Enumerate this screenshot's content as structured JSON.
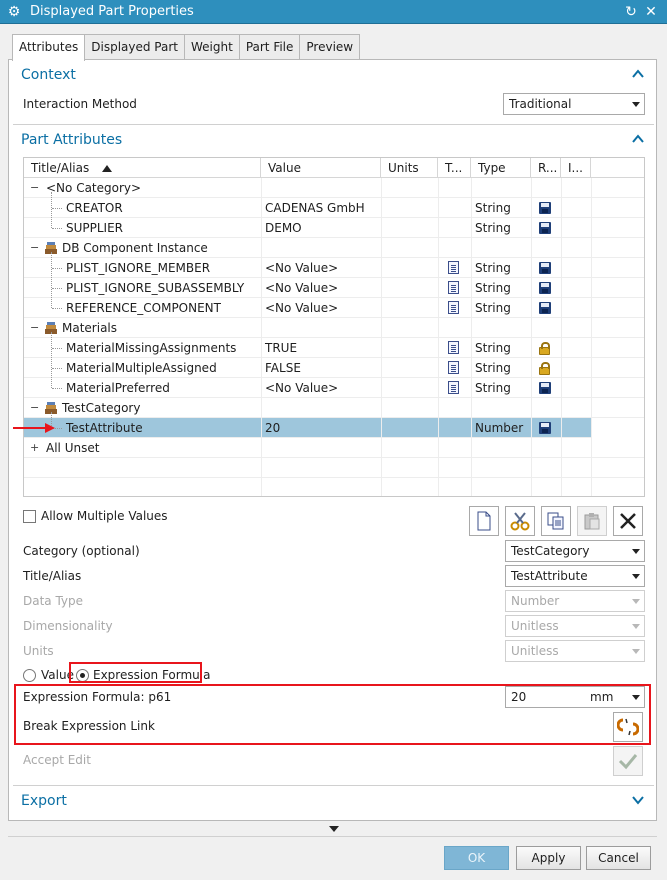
{
  "window": {
    "title": "Displayed Part Properties",
    "gear_icon": "gear-icon",
    "reset_icon": "reset-icon",
    "close_icon": "close-icon"
  },
  "tabs": [
    {
      "label": "Attributes",
      "active": true
    },
    {
      "label": "Displayed Part"
    },
    {
      "label": "Weight"
    },
    {
      "label": "Part File"
    },
    {
      "label": "Preview"
    }
  ],
  "context": {
    "title": "Context",
    "interaction_method_label": "Interaction Method",
    "interaction_method_value": "Traditional"
  },
  "part_attributes": {
    "title": "Part Attributes",
    "columns": [
      "Title/Alias",
      "Value",
      "Units",
      "T...",
      "Type",
      "R...",
      "I..."
    ],
    "rows": [
      {
        "kind": "category",
        "title": "<No Category>",
        "value": "",
        "type": "",
        "icon": "none"
      },
      {
        "kind": "item",
        "title": "CREATOR",
        "value": "CADENAS GmbH",
        "type": "String",
        "t": false,
        "r": "disk"
      },
      {
        "kind": "item",
        "title": "SUPPLIER",
        "value": "DEMO",
        "type": "String",
        "t": false,
        "r": "disk"
      },
      {
        "kind": "category",
        "title": "DB Component Instance",
        "icon": "books"
      },
      {
        "kind": "item",
        "title": "PLIST_IGNORE_MEMBER",
        "value": "<No Value>",
        "type": "String",
        "t": true,
        "r": "disk"
      },
      {
        "kind": "item",
        "title": "PLIST_IGNORE_SUBASSEMBLY",
        "value": "<No Value>",
        "type": "String",
        "t": true,
        "r": "disk"
      },
      {
        "kind": "item",
        "title": "REFERENCE_COMPONENT",
        "value": "<No Value>",
        "type": "String",
        "t": true,
        "r": "disk"
      },
      {
        "kind": "category",
        "title": "Materials",
        "icon": "books"
      },
      {
        "kind": "item",
        "title": "MaterialMissingAssignments",
        "value": "TRUE",
        "type": "String",
        "t": true,
        "r": "lock"
      },
      {
        "kind": "item",
        "title": "MaterialMultipleAssigned",
        "value": "FALSE",
        "type": "String",
        "t": true,
        "r": "lock"
      },
      {
        "kind": "item",
        "title": "MaterialPreferred",
        "value": "<No Value>",
        "type": "String",
        "t": true,
        "r": "disk"
      },
      {
        "kind": "category",
        "title": "TestCategory",
        "icon": "books"
      },
      {
        "kind": "item",
        "title": "TestAttribute",
        "value": "20",
        "type": "Number",
        "t": false,
        "r": "disk",
        "selected": true
      },
      {
        "kind": "collapsed",
        "title": "All Unset"
      }
    ],
    "allow_multiple_label": "Allow Multiple Values",
    "toolbar_icons": [
      "new-icon",
      "cut-icon",
      "copy-icon",
      "paste-icon",
      "delete-icon"
    ],
    "category_label": "Category (optional)",
    "category_value": "TestCategory",
    "title_alias_label": "Title/Alias",
    "title_alias_value": "TestAttribute",
    "data_type_label": "Data Type",
    "data_type_value": "Number",
    "dimensionality_label": "Dimensionality",
    "dimensionality_value": "Unitless",
    "units_label": "Units",
    "units_value": "Unitless",
    "radio_value_label": "Value",
    "radio_expression_label": "Expression Formula",
    "expression_label": "Expression Formula: p61",
    "expression_value": "20",
    "expression_unit": "mm",
    "break_link_label": "Break Expression Link",
    "accept_edit_label": "Accept Edit"
  },
  "export": {
    "title": "Export"
  },
  "footer": {
    "ok": "OK",
    "apply": "Apply",
    "cancel": "Cancel"
  }
}
